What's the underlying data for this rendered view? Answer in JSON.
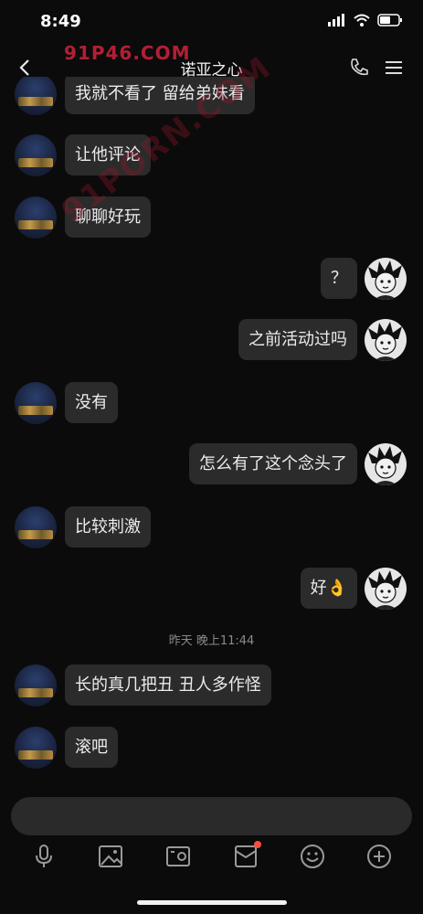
{
  "status": {
    "time": "8:49"
  },
  "nav": {
    "title": "诺亚之心"
  },
  "watermark": {
    "logo": "91P46.COM",
    "diagonal": "91PORN.COM"
  },
  "messages": [
    {
      "side": "left",
      "text": "我就不看了 留给弟妹看"
    },
    {
      "side": "left",
      "text": "让他评论"
    },
    {
      "side": "left",
      "text": "聊聊好玩"
    },
    {
      "side": "right",
      "text": "？"
    },
    {
      "side": "right",
      "text": "之前活动过吗"
    },
    {
      "side": "left",
      "text": "没有"
    },
    {
      "side": "right",
      "text": "怎么有了这个念头了"
    },
    {
      "side": "left",
      "text": "比较刺激"
    },
    {
      "side": "right",
      "text": "好👌"
    },
    {
      "side": "left",
      "text": "长的真几把丑 丑人多作怪"
    },
    {
      "side": "left",
      "text": "滚吧"
    }
  ],
  "timestamp": "昨天 晚上11:44",
  "toolbar": {
    "icons": [
      "microphone-icon",
      "image-icon",
      "camera-icon",
      "red-packet-icon",
      "emoji-icon",
      "plus-icon"
    ],
    "badge_color": "#ff4d3d"
  },
  "colors": {
    "background": "#0b0b0b",
    "bubble": "#2b2b2b",
    "input": "#2a2a2a"
  }
}
